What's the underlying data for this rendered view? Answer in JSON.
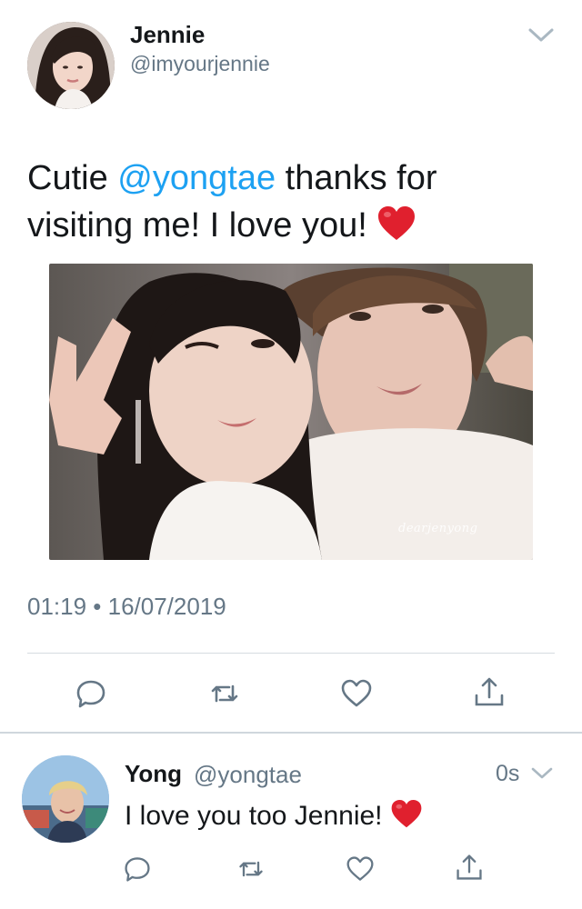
{
  "tweet": {
    "author_name": "Jennie",
    "author_handle": "@imyourjennie",
    "text_before": "Cutie ",
    "mention": "@yongtae",
    "text_after_1": " thanks for",
    "text_line_2": "visiting me! I love you! ",
    "emoji": "red-heart",
    "photo_watermark": "dearjenyong",
    "timestamp": "01:19 • 16/07/2019"
  },
  "reply": {
    "author_name": "Yong",
    "author_handle": "@yongtae",
    "time": "0s",
    "text": "I love you too Jennie! ",
    "emoji": "red-heart"
  },
  "icons": {
    "reply": "reply-icon",
    "retweet": "retweet-icon",
    "like": "like-icon",
    "share": "share-icon",
    "menu": "chevron-down-icon"
  },
  "colors": {
    "link": "#1da1f2",
    "secondary_text": "#657786",
    "primary_text": "#14171a",
    "divider": "#d6dce1",
    "heart": "#e0202e"
  }
}
